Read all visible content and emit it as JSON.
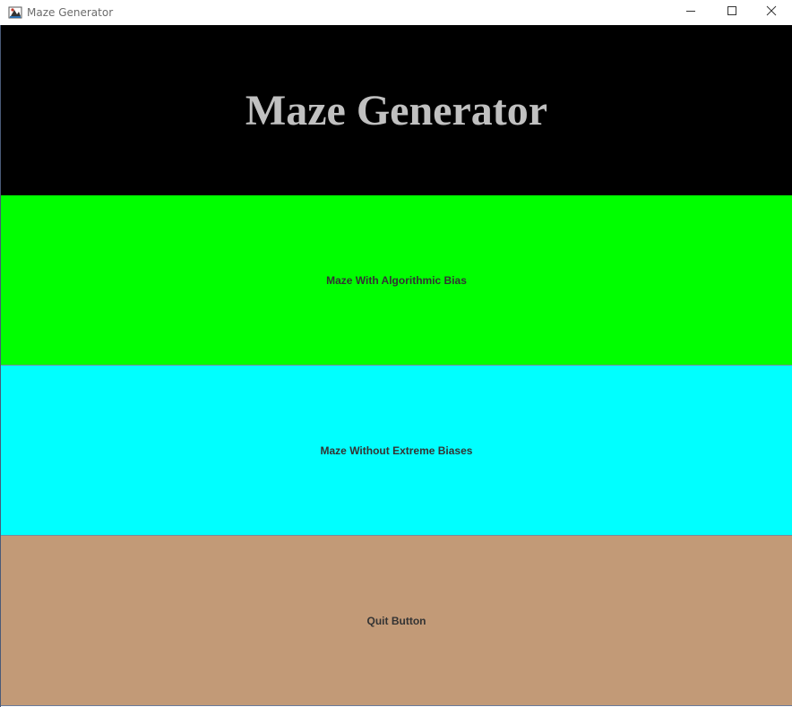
{
  "window": {
    "title": "Maze Generator"
  },
  "header": {
    "title": "Maze Generator"
  },
  "buttons": {
    "bias_label": "Maze With Algorithmic Bias",
    "no_bias_label": "Maze Without Extreme Biases",
    "quit_label": "Quit Button"
  },
  "colors": {
    "header_bg": "#000000",
    "title_color": "#c0c0c0",
    "bias_bg": "#00ff00",
    "no_bias_bg": "#00ffff",
    "quit_bg": "#c29a77"
  },
  "icons": {
    "app": "java-app-icon",
    "minimize": "minimize-icon",
    "maximize": "maximize-icon",
    "close": "close-icon"
  }
}
